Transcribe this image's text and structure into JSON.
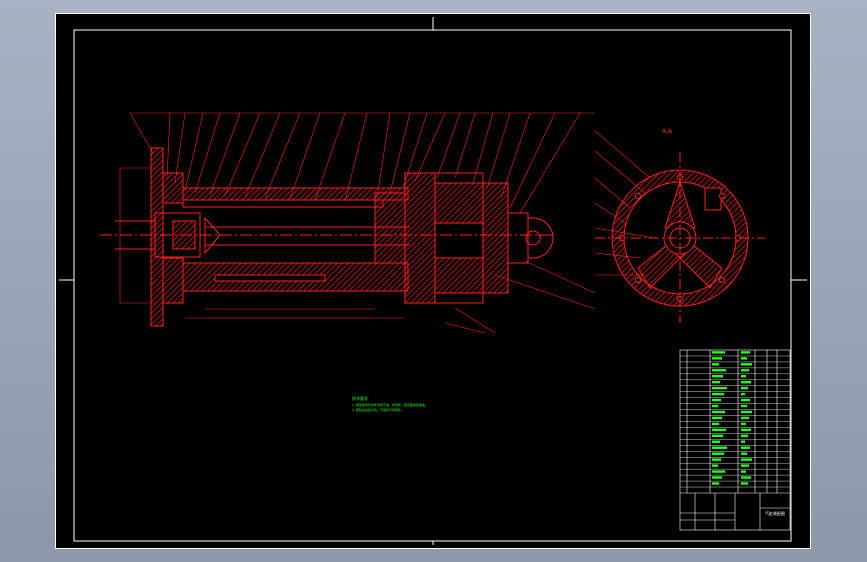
{
  "drawing": {
    "view_label": "A-A",
    "tech_requirements": {
      "heading": "技术要求",
      "lines": [
        "1. 装配前所有零件清洗干净，去毛刺，配合面涂润滑油。",
        "2. 装配后运动灵活，不得有卡滞现象。"
      ]
    },
    "title_block": {
      "drawing_title": "气缸装配图"
    },
    "colors": {
      "sheet": "#000000",
      "border": "#ffffff",
      "part_lines": "#ff2020",
      "hatch": "#e01818",
      "text_notes": "#20ff20",
      "table_lines": "#ffffff"
    }
  }
}
